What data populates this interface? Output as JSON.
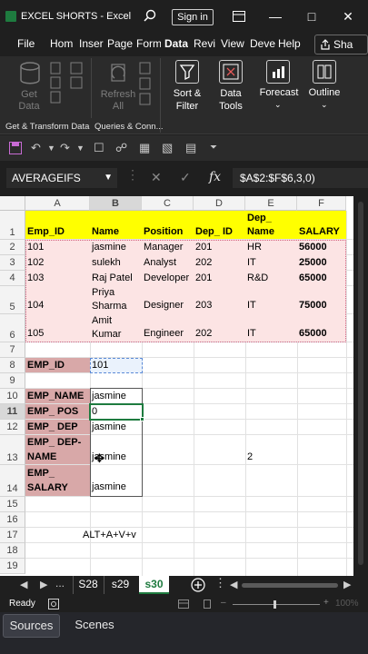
{
  "window": {
    "title": "EXCEL SHORTS  -  Excel",
    "signin_label": "Sign in"
  },
  "ribbon_tabs": [
    "File",
    "Hom",
    "Inser",
    "Page",
    "Form",
    "Data",
    "Revi",
    "View",
    "Deve",
    "Help"
  ],
  "active_tab": "Data",
  "share_label": "Sha",
  "ribbon": {
    "get_data": "Get\nData",
    "refresh_all": "Refresh\nAll",
    "sort_filter": "Sort &\nFilter",
    "data_tools": "Data\nTools",
    "forecast": "Forecast",
    "outline": "Outline",
    "group_get_transform": "Get & Transform Data",
    "group_queries": "Queries & Conn..."
  },
  "formula_bar": {
    "name_box": "AVERAGEIFS",
    "formula": "$A$2:$F$6,3,0)"
  },
  "columns": [
    "A",
    "B",
    "C",
    "D",
    "E",
    "F"
  ],
  "rows": [
    "1",
    "2",
    "3",
    "4",
    "5",
    "6",
    "7",
    "8",
    "9",
    "10",
    "11",
    "12",
    "13",
    "14",
    "15",
    "16",
    "17",
    "18",
    "19"
  ],
  "table": {
    "headers": [
      "Emp_ID",
      "Name",
      "Position",
      "Dep_ ID",
      "Dep_\nName",
      "SALARY"
    ],
    "records": [
      [
        "101",
        "jasmine",
        "Manager",
        "201",
        "HR",
        "56000"
      ],
      [
        "102",
        "sulekh",
        "Analyst",
        "202",
        "IT",
        "25000"
      ],
      [
        "103",
        "Raj Patel",
        "Developer",
        "201",
        "R&D",
        "65000"
      ],
      [
        "104",
        "Priya\nSharma",
        "Designer",
        "203",
        "IT",
        "75000"
      ],
      [
        "105",
        "Amit\nKumar",
        "Engineer",
        "202",
        "IT",
        "65000"
      ]
    ]
  },
  "lookup": {
    "emp_id_label": "EMP_ID",
    "emp_id_value": "101",
    "fields": [
      {
        "label": "EMP_NAME",
        "value": "jasmine"
      },
      {
        "label": "EMP_ POS",
        "value": "0"
      },
      {
        "label": "EMP_ DEP",
        "value": "jasmine"
      },
      {
        "label": "EMP_ DEP-\nNAME",
        "value": "jasmine"
      },
      {
        "label": "EMP_\nSALARY",
        "value": "jasmine"
      }
    ],
    "e13_value": "2"
  },
  "shortcut_note": "ALT+A+V+v",
  "sheet_tabs": [
    "S28",
    "s29",
    "s30"
  ],
  "active_sheet": "s30",
  "status": {
    "ready": "Ready",
    "zoom": "100%"
  },
  "obs_tabs": [
    "Sources",
    "Scenes"
  ],
  "colors": {
    "header_yellow": "#ffff00",
    "table_pink": "#fce4e4",
    "label_rose": "#d8a8a8",
    "excel_green": "#1e7b3f"
  }
}
